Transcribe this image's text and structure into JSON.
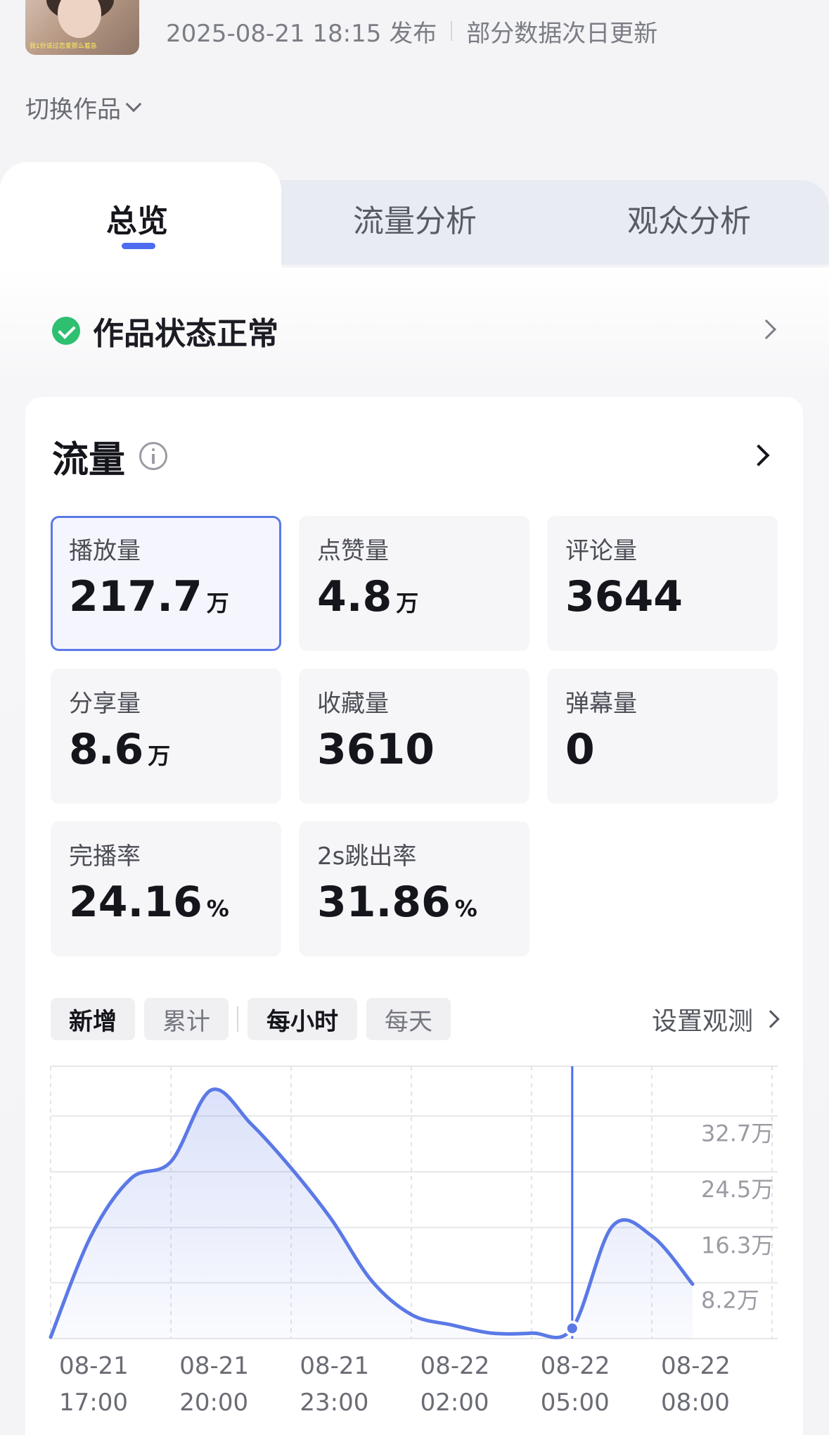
{
  "header": {
    "thumbnail_caption": "我1份该过恋爱那么着急",
    "publish_time": "2025-08-21 18:15 发布",
    "update_note": "部分数据次日更新",
    "switch_label": "切换作品"
  },
  "tabs": [
    {
      "label": "总览",
      "active": true
    },
    {
      "label": "流量分析",
      "active": false
    },
    {
      "label": "观众分析",
      "active": false
    }
  ],
  "status": {
    "text": "作品状态正常"
  },
  "traffic": {
    "title": "流量",
    "metrics": [
      {
        "label": "播放量",
        "value": "217.7",
        "unit": "万",
        "selected": true
      },
      {
        "label": "点赞量",
        "value": "4.8",
        "unit": "万"
      },
      {
        "label": "评论量",
        "value": "3644",
        "unit": ""
      },
      {
        "label": "分享量",
        "value": "8.6",
        "unit": "万"
      },
      {
        "label": "收藏量",
        "value": "3610",
        "unit": ""
      },
      {
        "label": "弹幕量",
        "value": "0",
        "unit": ""
      },
      {
        "label": "完播率",
        "value": "24.16",
        "unit": "%"
      },
      {
        "label": "2s跳出率",
        "value": "31.86",
        "unit": "%"
      }
    ],
    "filters": {
      "mode": [
        "新增",
        "累计"
      ],
      "mode_selected": "新增",
      "granularity": [
        "每小时",
        "每天"
      ],
      "granularity_selected": "每小时",
      "observe_label": "设置观测"
    }
  },
  "colors": {
    "accent": "#4c6df0",
    "line": "#5b79e6",
    "success": "#2fbf71"
  },
  "chart_data": {
    "type": "area",
    "x": [
      "08-21 16:00",
      "08-21 17:00",
      "08-21 18:00",
      "08-21 19:00",
      "08-21 20:00",
      "08-21 21:00",
      "08-21 22:00",
      "08-21 23:00",
      "08-22 00:00",
      "08-22 01:00",
      "08-22 02:00",
      "08-22 03:00",
      "08-22 04:00",
      "08-22 05:00",
      "08-22 06:00",
      "08-22 07:00",
      "08-22 08:00"
    ],
    "values": [
      0.2,
      15.0,
      23.5,
      26.0,
      36.5,
      31.5,
      25.0,
      17.5,
      8.5,
      3.5,
      2.0,
      0.8,
      0.8,
      1.5,
      16.5,
      15.0,
      8.0
    ],
    "unit": "万",
    "ylim": [
      0,
      40
    ],
    "yticks": [
      {
        "label": "8.2万",
        "v": 8.2
      },
      {
        "label": "16.3万",
        "v": 16.3
      },
      {
        "label": "24.5万",
        "v": 24.5
      },
      {
        "label": "32.7万",
        "v": 32.7
      }
    ],
    "xticks": [
      {
        "date": "08-21",
        "time": "17:00",
        "i": 1
      },
      {
        "date": "08-21",
        "time": "20:00",
        "i": 4
      },
      {
        "date": "08-21",
        "time": "23:00",
        "i": 7
      },
      {
        "date": "08-22",
        "time": "02:00",
        "i": 10
      },
      {
        "date": "08-22",
        "time": "05:00",
        "i": 13
      },
      {
        "date": "08-22",
        "time": "08:00",
        "i": 16
      }
    ],
    "cursor_index": 13,
    "grid": true
  }
}
